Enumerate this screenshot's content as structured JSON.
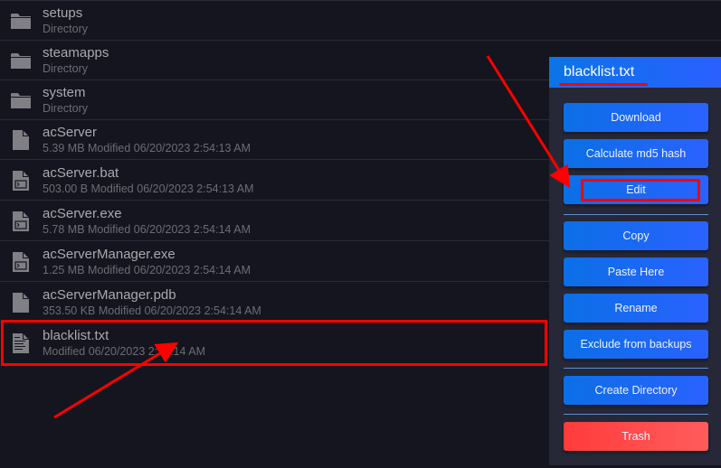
{
  "file_list": {
    "items": [
      {
        "name": "setups",
        "meta": "Directory",
        "icon": "folder-icon"
      },
      {
        "name": "steamapps",
        "meta": "Directory",
        "icon": "folder-icon"
      },
      {
        "name": "system",
        "meta": "Directory",
        "icon": "folder-icon"
      },
      {
        "name": "acServer",
        "meta": "5.39 MB Modified 06/20/2023 2:54:13 AM",
        "icon": "file-icon"
      },
      {
        "name": "acServer.bat",
        "meta": "503.00 B Modified 06/20/2023 2:54:13 AM",
        "icon": "terminal-file-icon"
      },
      {
        "name": "acServer.exe",
        "meta": "5.78 MB Modified 06/20/2023 2:54:14 AM",
        "icon": "terminal-file-icon"
      },
      {
        "name": "acServerManager.exe",
        "meta": "1.25 MB Modified 06/20/2023 2:54:14 AM",
        "icon": "terminal-file-icon"
      },
      {
        "name": "acServerManager.pdb",
        "meta": "353.50 KB Modified 06/20/2023 2:54:14 AM",
        "icon": "file-icon"
      },
      {
        "name": "blacklist.txt",
        "meta": "Modified 06/20/2023 2:54:14 AM",
        "icon": "text-file-icon"
      }
    ]
  },
  "context_menu": {
    "title": "blacklist.txt",
    "buttons": {
      "download": "Download",
      "md5": "Calculate md5 hash",
      "edit": "Edit",
      "copy": "Copy",
      "paste": "Paste Here",
      "rename": "Rename",
      "exclude": "Exclude from backups",
      "create_dir": "Create Directory",
      "trash": "Trash"
    }
  },
  "colors": {
    "accent": "#1a6cf5",
    "danger": "#ff4a4a",
    "annotation": "#ff0000",
    "background": "#14151e",
    "panel": "#262838"
  }
}
